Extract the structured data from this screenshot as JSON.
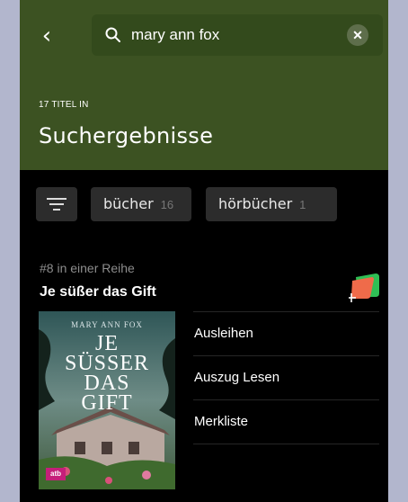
{
  "header": {
    "back_icon": "chevron-left-icon",
    "search": {
      "icon": "search-icon",
      "value": "mary ann fox",
      "clear_icon": "close-icon"
    },
    "count_label": "17 TITEL IN",
    "title": "Suchergebnisse",
    "color": "#3c5222"
  },
  "filters": {
    "filter_icon": "filter-icon",
    "tabs": [
      {
        "label": "bücher",
        "count": "16"
      },
      {
        "label": "hörbücher",
        "count": "1"
      }
    ]
  },
  "result": {
    "series": "#8 in einer Reihe",
    "title": "Je süßer das Gift",
    "tag_icon": "add-to-tag-icon",
    "cover": {
      "author": "MARY ANN FOX",
      "title_lines": [
        "JE",
        "SÜSSER",
        "DAS",
        "GIFT"
      ],
      "publisher": "atb"
    },
    "actions": [
      "Ausleihen",
      "Auszug Lesen",
      "Merkliste"
    ]
  }
}
